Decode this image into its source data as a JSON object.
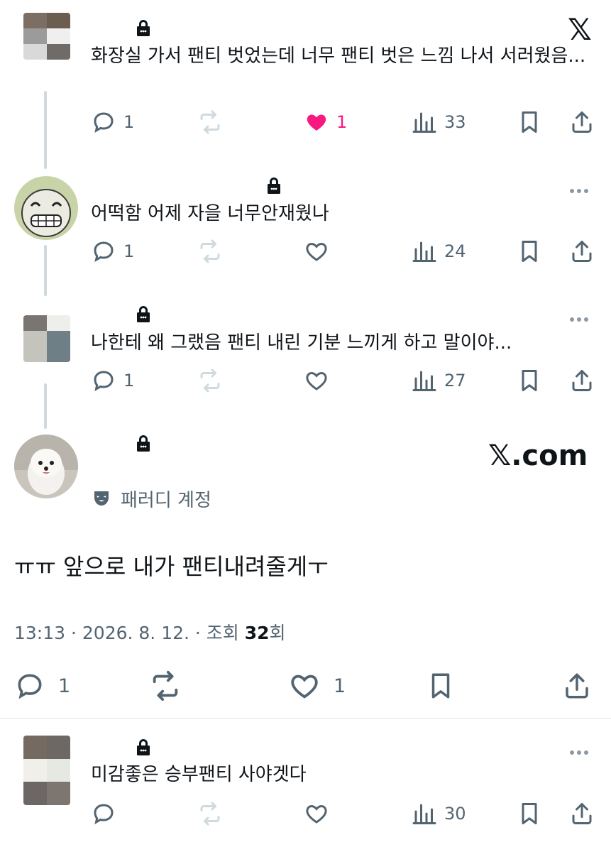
{
  "brand": {
    "x_logo": "𝕏",
    "x_com": "𝕏.com"
  },
  "colors": {
    "like_active": "#f91880",
    "icon_gray": "#536471",
    "text": "#0f1419",
    "line": "#cfd9de"
  },
  "replies": [
    {
      "text": "화장실 가서 팬티 벗었는데 너무 팬티 벗은 느낌 나서 서러웠음...",
      "reply_count": "1",
      "like_count": "1",
      "liked": true,
      "views": "33"
    },
    {
      "text": "어떡함 어제 자을 너무안재웠나",
      "reply_count": "1",
      "like_count": "",
      "views": "24"
    },
    {
      "text": "나한테 왜 그랬음 팬티 내린 기분 느끼게 하고 말이야...",
      "reply_count": "1",
      "like_count": "",
      "views": "27"
    }
  ],
  "main_tweet": {
    "badge_label": "패러디 계정",
    "text": "ㅠㅠ 앞으로 내가 팬티내려줄게ㅜ",
    "meta_prefix": "13:13 · 2026. 8. 12. · 조회 ",
    "views": "32",
    "views_suffix": "회",
    "reply_count": "1",
    "like_count": "1"
  },
  "bottom_reply": {
    "text": "미감좋은 승부팬티 사야겟다",
    "views": "30"
  }
}
